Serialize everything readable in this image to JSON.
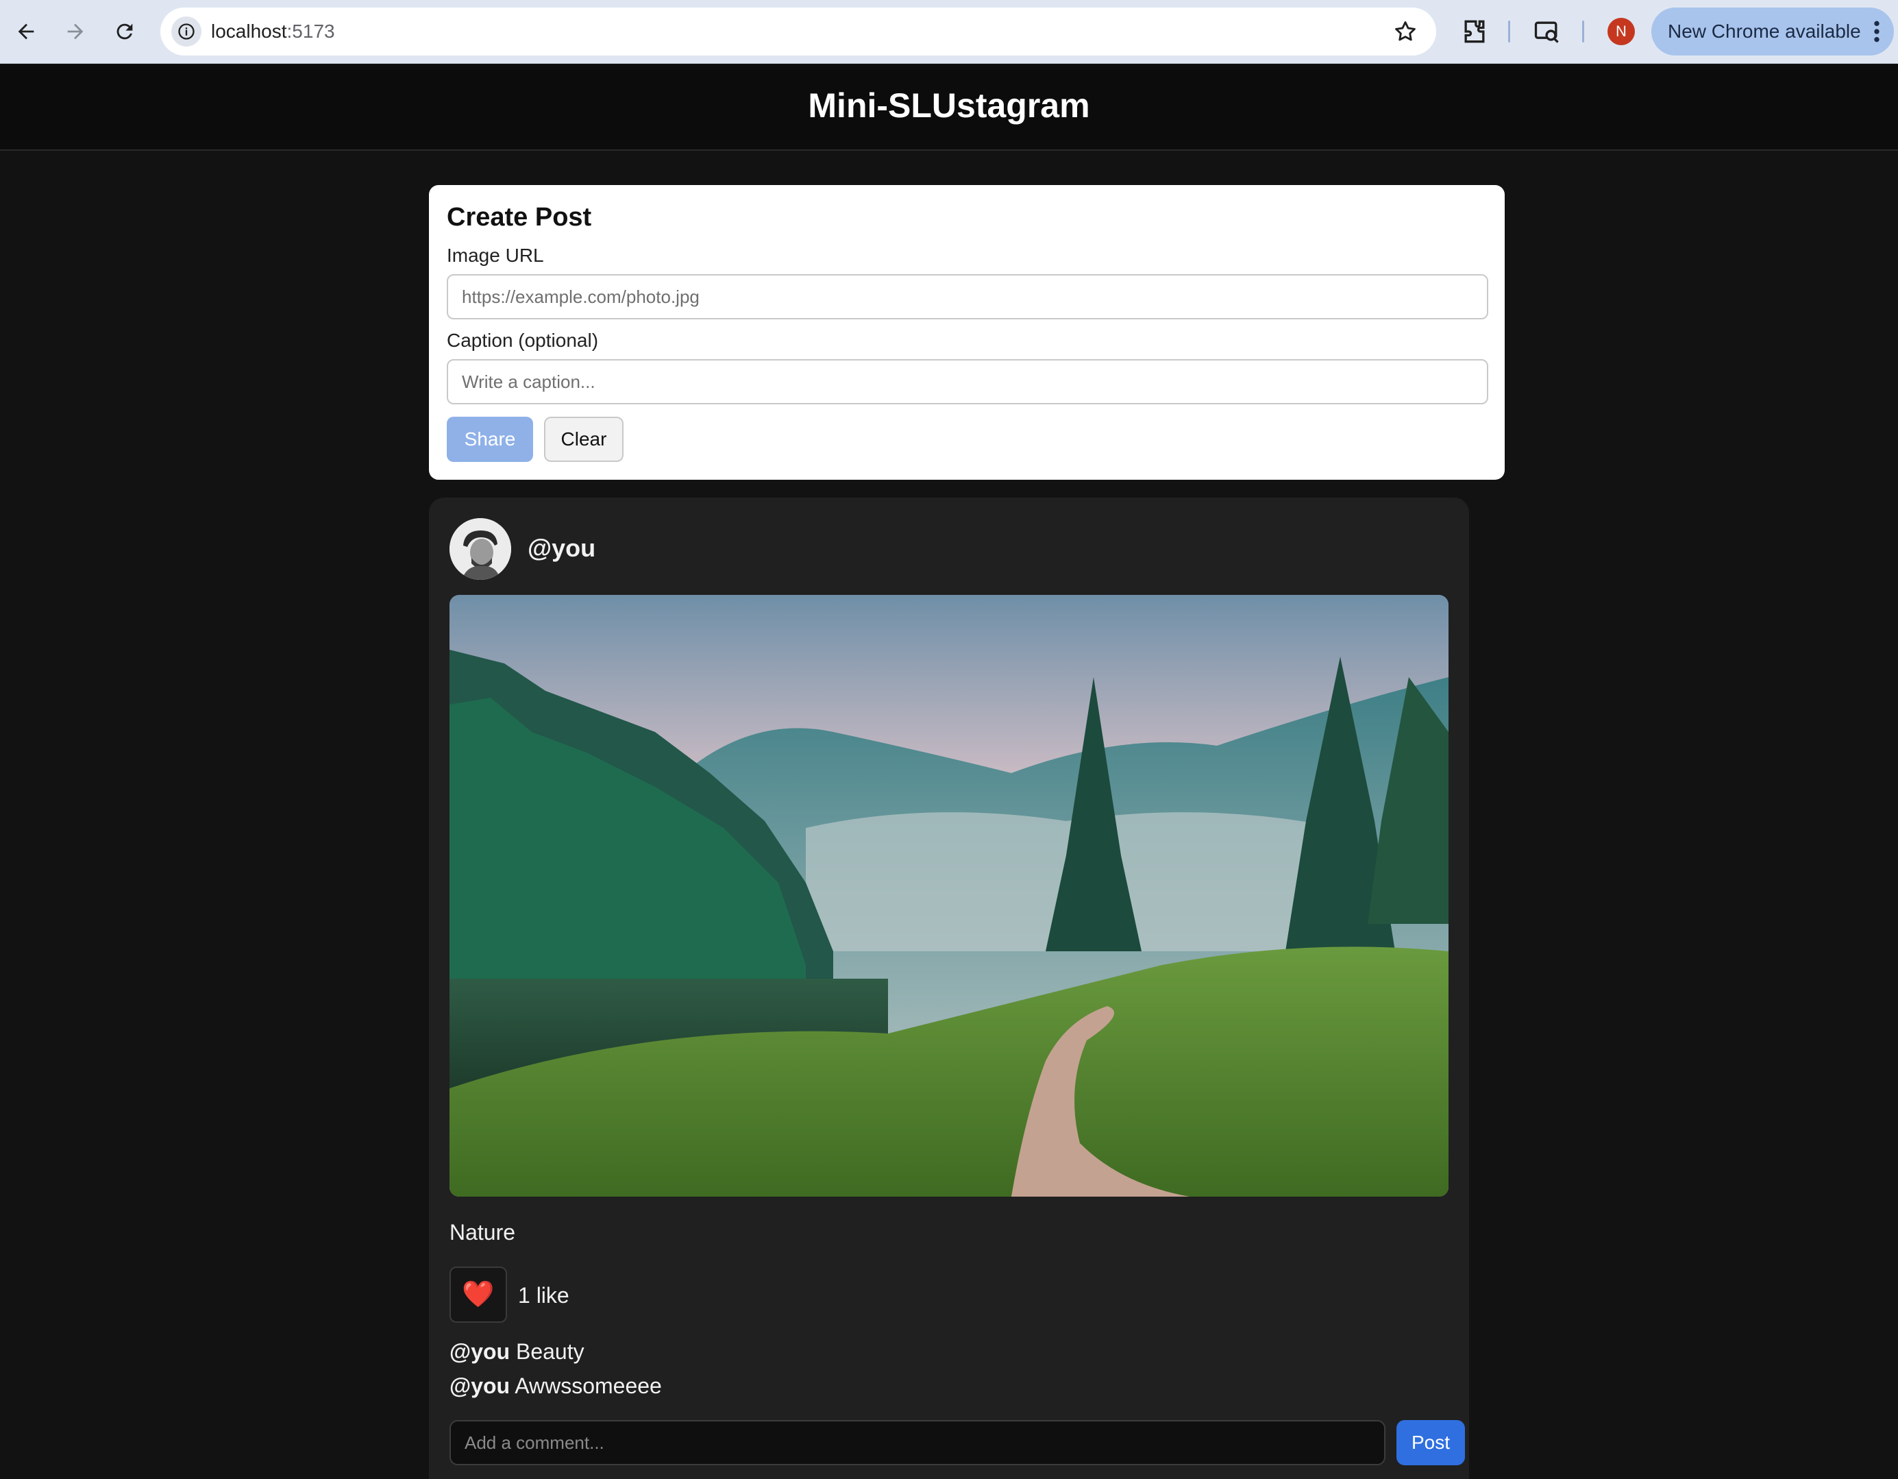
{
  "browser": {
    "url_host": "localhost",
    "url_port": ":5173",
    "profile_initial": "N",
    "update_label": "New Chrome available"
  },
  "app": {
    "title": "Mini-SLUstagram"
  },
  "create_post": {
    "title": "Create Post",
    "image_url_label": "Image URL",
    "image_url_placeholder": "https://example.com/photo.jpg",
    "image_url_value": "",
    "caption_label": "Caption (optional)",
    "caption_placeholder": "Write a caption...",
    "caption_value": "",
    "share_label": "Share",
    "clear_label": "Clear"
  },
  "post": {
    "username": "@you",
    "caption": "Nature",
    "like_icon": "❤️",
    "like_count_text": "1 like",
    "comments": [
      {
        "user": "@you",
        "text": "Beauty"
      },
      {
        "user": "@you",
        "text": "Awwssomeeee"
      }
    ],
    "comment_placeholder": "Add a comment...",
    "post_label": "Post"
  },
  "colors": {
    "background": "#121212",
    "card_dark": "#202020",
    "accent_blue": "#2f6fe0",
    "share_disabled": "#8fb1e8"
  }
}
